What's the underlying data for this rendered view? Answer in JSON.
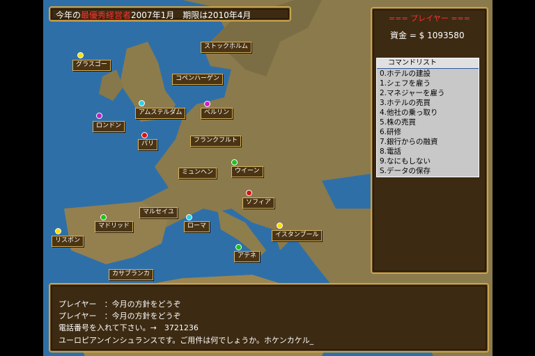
{
  "topbar": {
    "prefix": "今年の",
    "highlight": "最優秀経営者",
    "text": "2007年1月　期限は2010年4月"
  },
  "player": {
    "title": "=== プレイヤー ===",
    "money": "資金 = $ 1093580"
  },
  "command_list": {
    "header": "コマンドリスト",
    "items": [
      "0.ホテルの建設",
      "1.シェフを雇う",
      "2.マネジャーを雇う",
      "3.ホテルの売買",
      "4.他社の乗っ取り",
      "5.株の売買",
      "6.研修",
      "7.銀行からの融資",
      "8.電話",
      "9.なにもしない",
      "S.データの保存"
    ]
  },
  "cities": [
    {
      "name": "ストックホルム",
      "dot": ""
    },
    {
      "name": "グラスゴー",
      "dot": "#f5e100"
    },
    {
      "name": "コペンハーゲン",
      "dot": ""
    },
    {
      "name": "アムステルダム",
      "dot": "#30d0e8"
    },
    {
      "name": "ベルリン",
      "dot": "#d020c8"
    },
    {
      "name": "ロンドン",
      "dot": "#c020c0"
    },
    {
      "name": "パリ",
      "dot": "#e01010"
    },
    {
      "name": "フランクフルト",
      "dot": ""
    },
    {
      "name": "ウイーン",
      "dot": "#20c020"
    },
    {
      "name": "ミュンヘン",
      "dot": ""
    },
    {
      "name": "ソフィア",
      "dot": "#e01010"
    },
    {
      "name": "マルセイユ",
      "dot": ""
    },
    {
      "name": "マドリッド",
      "dot": "#20c020"
    },
    {
      "name": "ローマ",
      "dot": "#30d0e8"
    },
    {
      "name": "リスボン",
      "dot": "#f5e100"
    },
    {
      "name": "イスタンブール",
      "dot": "#f5e100"
    },
    {
      "name": "アテネ",
      "dot": "#20c020"
    },
    {
      "name": "カサブランカ",
      "dot": ""
    }
  ],
  "messages": [
    "プレイヤー　：今月の方針をどうぞ",
    "プレイヤー　：今月の方針をどうぞ",
    "電話番号を入れて下さい。→　3721236",
    "ユーロピアンインシュランスです。ご用件は何でしょうか。ホケンカケル_"
  ]
}
